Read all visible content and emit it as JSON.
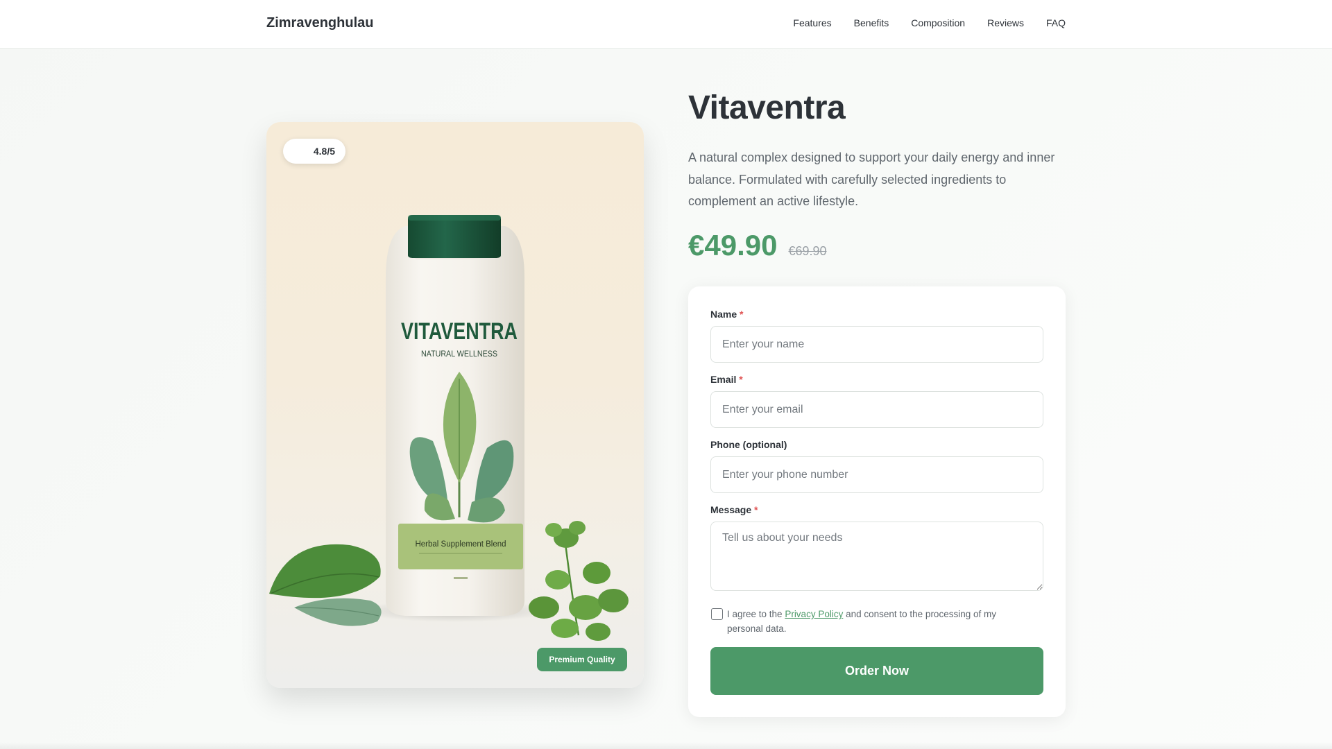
{
  "header": {
    "brand": "Zimravenghulau",
    "nav": [
      "Features",
      "Benefits",
      "Composition",
      "Reviews",
      "FAQ"
    ]
  },
  "hero": {
    "rating": "4.8/5",
    "quality_badge": "Premium Quality",
    "bottle": {
      "brand_text": "VITAVENTRA",
      "subtitle_text": "NATURAL WELLNESS",
      "label_text": "Herbal Supplement Blend"
    }
  },
  "product": {
    "title": "Vitaventra",
    "description": "A natural complex designed to support your daily energy and inner balance. Formulated with carefully selected ingredients to complement an active lifestyle.",
    "price": "€49.90",
    "old_price": "€69.90"
  },
  "form": {
    "name_label": "Name",
    "name_placeholder": "Enter your name",
    "email_label": "Email",
    "email_placeholder": "Enter your email",
    "phone_label": "Phone (optional)",
    "phone_placeholder": "Enter your phone number",
    "message_label": "Message",
    "message_placeholder": "Tell us about your needs",
    "required_mark": "*",
    "consent_prefix": "I agree to the ",
    "consent_link": "Privacy Policy",
    "consent_suffix": " and consent to the processing of my personal data.",
    "submit_label": "Order Now"
  },
  "colors": {
    "accent": "#4c9968",
    "bottle_cap": "#1f5a3c",
    "label": "#a9c27a"
  }
}
